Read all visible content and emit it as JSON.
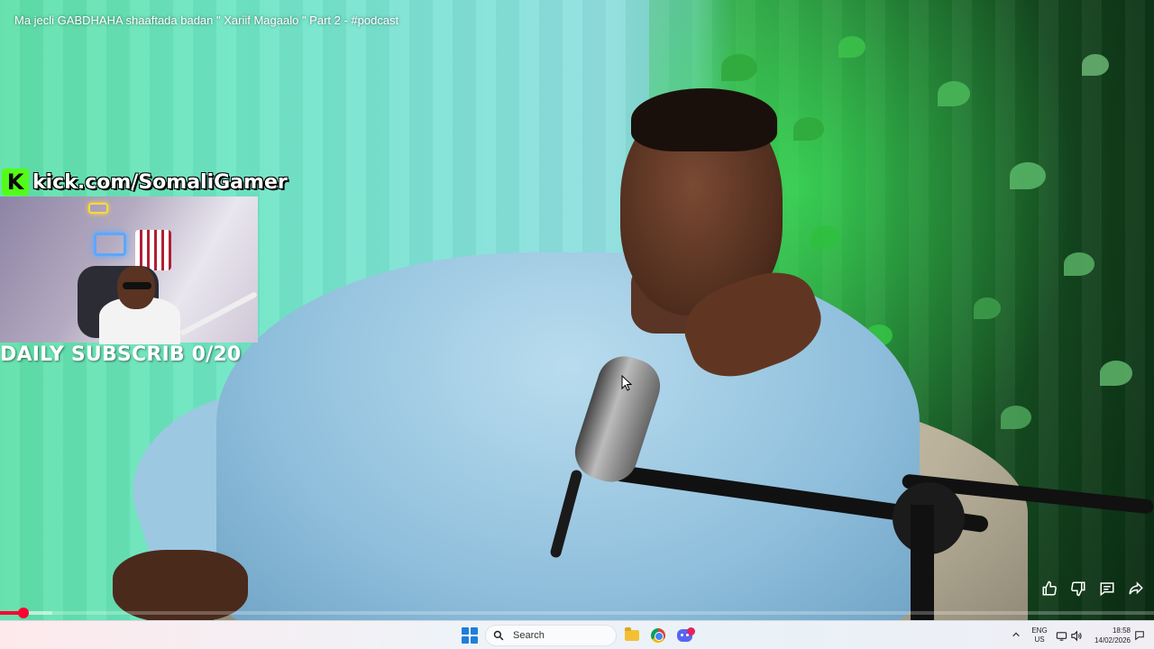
{
  "video": {
    "title": "Ma jecli GABDHAHA shaaftada badan \" Xariif Magaalo \" Part 2 - #podcast",
    "progress_fraction": 0.02,
    "loaded_fraction": 0.045
  },
  "overlay": {
    "kick_logo_letter": "K",
    "kick_url": "kick.com/SomaliGamer",
    "subscribe_goal": "DAILY SUBSCRIB 0/20"
  },
  "actions": {
    "icons": [
      "like-icon",
      "dislike-icon",
      "comments-icon",
      "share-icon"
    ]
  },
  "taskbar": {
    "search_label": "Search",
    "lang_line1": "ENG",
    "lang_line2": "US",
    "time": "18:58",
    "date": "14/02/2026",
    "accent_color": "#1e7fd8"
  }
}
